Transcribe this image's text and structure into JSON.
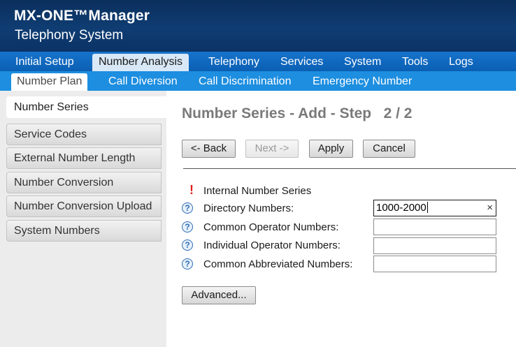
{
  "app": {
    "brand": "MX-ONE™Manager",
    "subtitle": "Telephony System"
  },
  "main_nav": {
    "items": [
      {
        "label": "Initial Setup"
      },
      {
        "label": "Number Analysis",
        "active": true
      },
      {
        "label": "Telephony"
      },
      {
        "label": "Services"
      },
      {
        "label": "System"
      },
      {
        "label": "Tools"
      },
      {
        "label": "Logs"
      }
    ]
  },
  "sub_nav": {
    "items": [
      {
        "label": "Number Plan",
        "active": true
      },
      {
        "label": "Call Diversion"
      },
      {
        "label": "Call Discrimination"
      },
      {
        "label": "Emergency Number"
      }
    ]
  },
  "sidebar": {
    "items": [
      {
        "label": "Number Series",
        "active": true
      },
      {
        "label": "Service Codes"
      },
      {
        "label": "External Number Length"
      },
      {
        "label": "Number Conversion"
      },
      {
        "label": "Number Conversion Upload"
      },
      {
        "label": "System Numbers"
      }
    ]
  },
  "page": {
    "title": "Number Series - Add - Step   2 / 2"
  },
  "buttons": {
    "back": "<- Back",
    "next": "Next ->",
    "apply": "Apply",
    "cancel": "Cancel",
    "advanced": "Advanced..."
  },
  "form": {
    "required_mark": "!",
    "required_label": "Internal Number Series",
    "hint_icon": "?",
    "clear_icon": "×",
    "fields": [
      {
        "label": "Directory Numbers:",
        "value": "1000-2000"
      },
      {
        "label": "Common Operator Numbers:",
        "value": ""
      },
      {
        "label": "Individual Operator Numbers:",
        "value": ""
      },
      {
        "label": "Common Abbreviated Numbers:",
        "value": ""
      }
    ]
  },
  "colors": {
    "header_dark": "#0f3d73",
    "main_nav": "#0a5fb3",
    "sub_nav": "#1d8ee0",
    "required": "#e0201c",
    "title_gray": "#7a7a7a"
  }
}
